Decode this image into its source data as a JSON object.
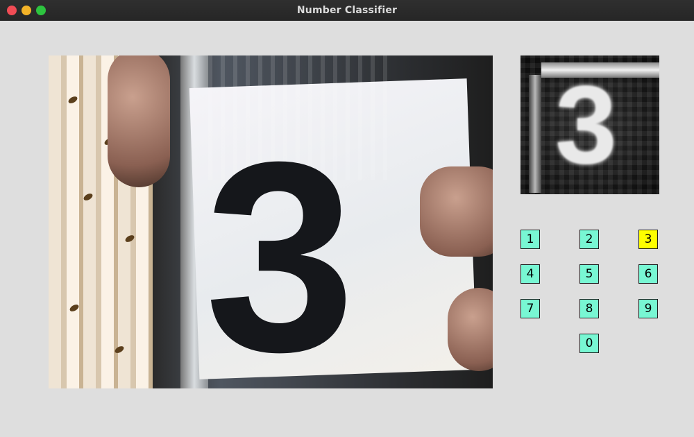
{
  "window": {
    "title": "Number Classifier"
  },
  "keypad": {
    "keys": [
      "1",
      "2",
      "3",
      "4",
      "5",
      "6",
      "7",
      "8",
      "9",
      "0"
    ],
    "selected": "3"
  },
  "colors": {
    "key_bg": "#78f7d3",
    "key_selected_bg": "#ffff00",
    "titlebar": "#2b2b2b"
  },
  "camera": {
    "digit_shown": "3"
  },
  "processed": {
    "digit_shown": "3"
  }
}
